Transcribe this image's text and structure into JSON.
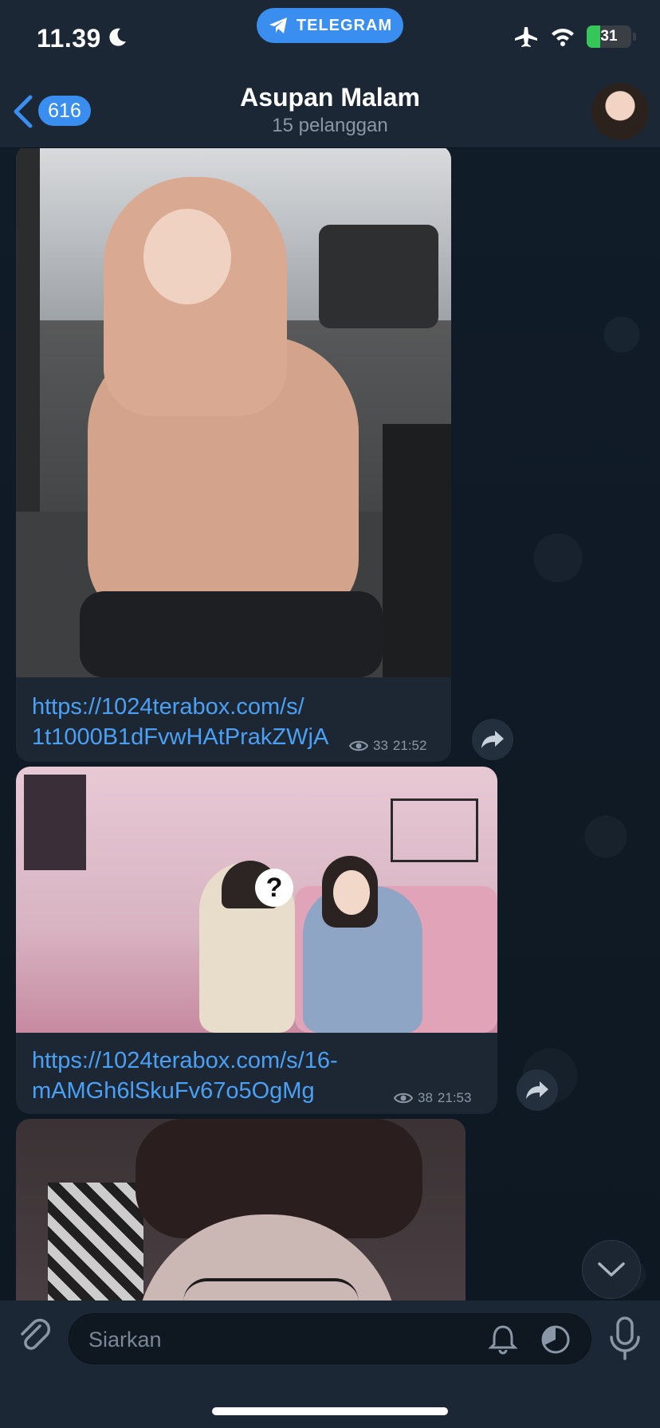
{
  "status_bar": {
    "time": "11.39",
    "app_pill": "TELEGRAM",
    "battery": "31",
    "battery_level_percent": 31,
    "icons": [
      "moon-icon",
      "airplane-icon",
      "wifi-icon",
      "battery-icon"
    ]
  },
  "header": {
    "back_count": "616",
    "title": "Asupan Malam",
    "subtitle": "15 pelanggan"
  },
  "messages": [
    {
      "link_line1": "https://1024terabox.com/s/",
      "link_line2": "1t1000B1dFvwHAtPrakZWjA",
      "views": "33",
      "time": "21:52"
    },
    {
      "link_line1": "https://1024terabox.com/s/16-",
      "link_line2": "mAMGh6lSkuFv67o5OgMg",
      "views": "38",
      "time": "21:53"
    }
  ],
  "input": {
    "placeholder": "Siarkan"
  },
  "colors": {
    "accent": "#3a8ef0",
    "link": "#4aa0f5",
    "bubble": "#1d2733",
    "bar": "#1b2735"
  }
}
